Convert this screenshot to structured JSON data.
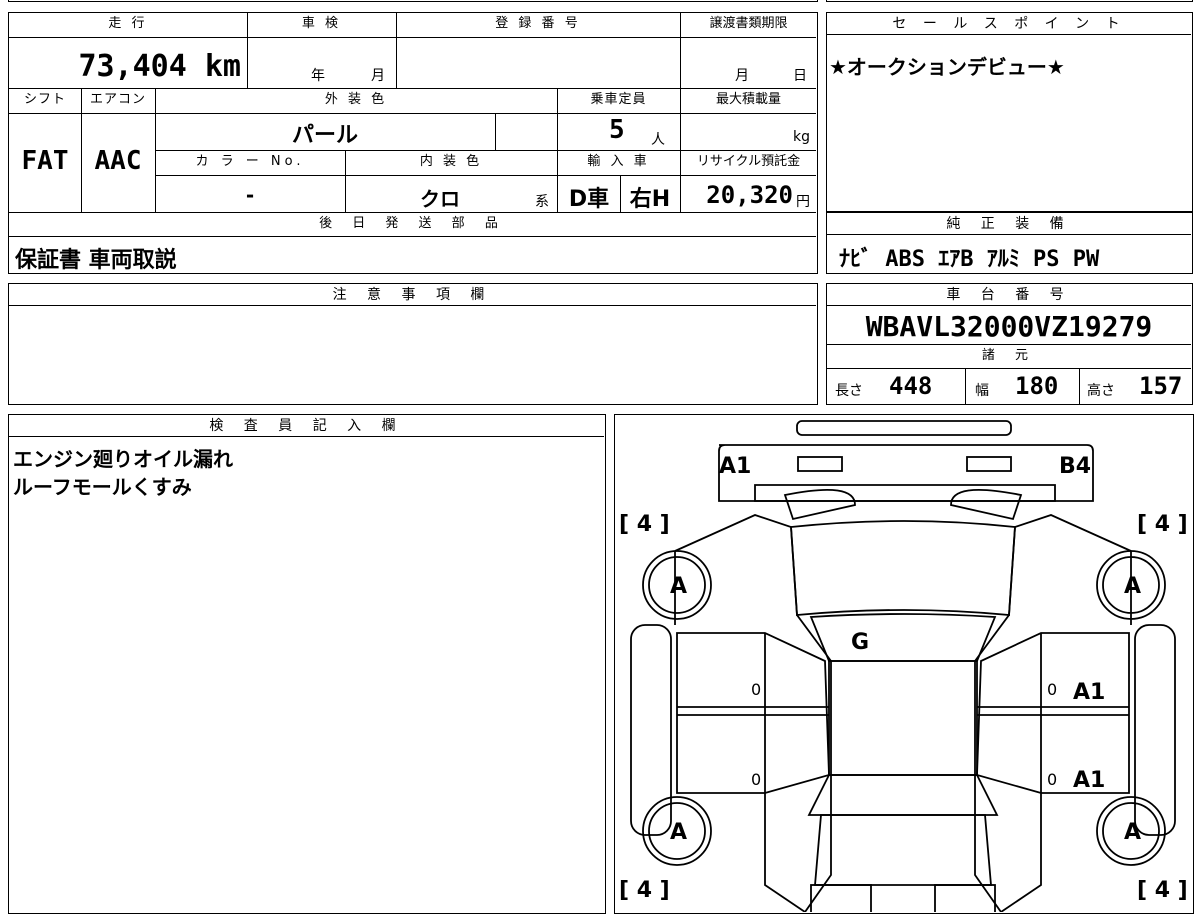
{
  "top_table": {
    "mileage_label": "走 行",
    "inspection_label": "車 検",
    "reg_no_label": "登 録 番 号",
    "transfer_deadline_label": "譲渡書類期限",
    "mileage_value": "73,404 km",
    "inspection_year_unit": "年",
    "inspection_month_unit": "月",
    "deadline_month_unit": "月",
    "deadline_day_unit": "日",
    "shift_label": "シフト",
    "aircon_label": "エアコン",
    "exterior_color_label": "外 装 色",
    "capacity_label": "乗車定員",
    "max_load_label": "最大積載量",
    "shift_value": "FAT",
    "aircon_value": "AAC",
    "exterior_color_value": "パール",
    "capacity_value": "5",
    "capacity_unit": "人",
    "load_unit": "kg",
    "color_no_label": "カ ラ ー No.",
    "interior_color_label": "内 装 色",
    "import_label": "輸 入 車",
    "recycle_label": "リサイクル預託金",
    "color_no_value": "-",
    "interior_color_value": "クロ",
    "interior_color_unit": "系",
    "import_dealer_value": "D車",
    "import_handle_value": "右H",
    "recycle_value": "20,320",
    "recycle_unit": "円"
  },
  "later_parts": {
    "label": "後 日 発 送 部 品",
    "value": "保証書 車両取説"
  },
  "notes": {
    "label": "注 意 事 項 欄",
    "value": ""
  },
  "sales_point": {
    "label": "セ ー ル ス ポ イ ン ト",
    "value": "★オークションデビュー★"
  },
  "genuine_equipment": {
    "label": "純 正 装 備",
    "value": "ﾅﾋﾞ ABS ｴｱB ｱﾙﾐ PS PW"
  },
  "chassis": {
    "label": "車 台 番 号",
    "value": "WBAVL32000VZ19279"
  },
  "specs": {
    "label": "諸 元",
    "length_label": "長さ",
    "length_value": "448",
    "width_label": "幅",
    "width_value": "180",
    "height_label": "高さ",
    "height_value": "157"
  },
  "inspector": {
    "label": "検 査 員 記 入 欄",
    "line1": "エンジン廻りオイル漏れ",
    "line2": "ルーフモールくすみ"
  },
  "diagram": {
    "front_left": "A1",
    "front_right": "B4",
    "tire_fl": "[ 4 ]",
    "tire_fr": "[ 4 ]",
    "tire_rl": "[ 4 ]",
    "tire_rr": "[ 4 ]",
    "wheel_fl": "A",
    "wheel_fr": "A",
    "wheel_rl": "A",
    "wheel_rr": "A",
    "windshield": "G",
    "door_fr": "A1",
    "door_rr": "A1",
    "door_fl_mark": "0",
    "door_rl_mark": "0",
    "door_fr_mark": "0",
    "door_rr_mark": "0"
  }
}
